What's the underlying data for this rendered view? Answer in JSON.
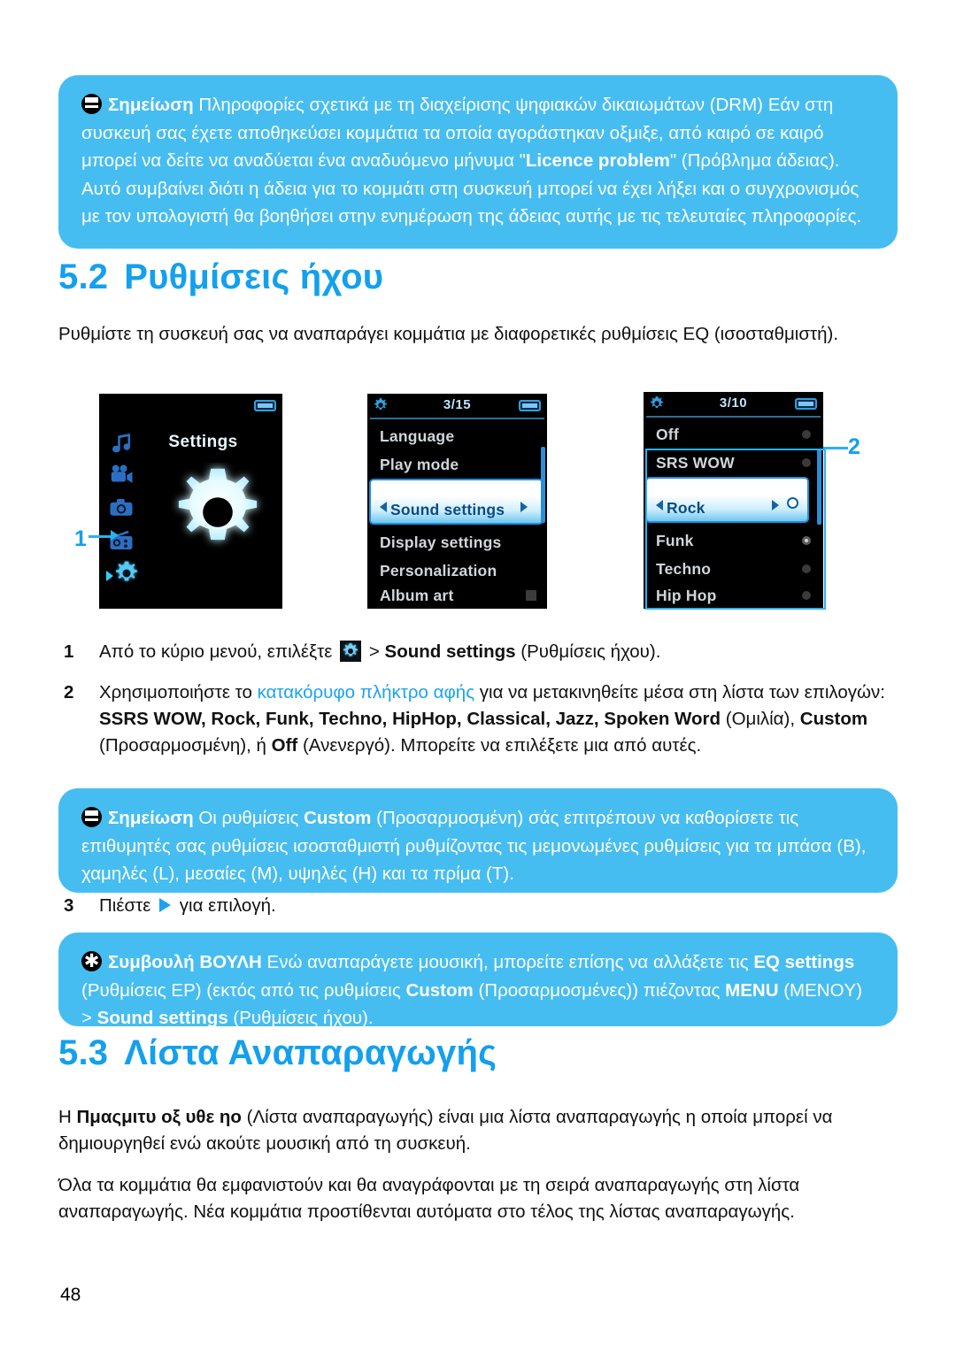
{
  "page_number": "48",
  "notes": {
    "note_drm": {
      "icon": "note-icon",
      "label": "Σημείωση",
      "text": " Πληροφορίες σχετικά με τη διαχείρισης ψηφιακών δικαιωμάτων (DRM) Εάν στη συσκευή σας έχετε αποθηκεύσει κομμάτια τα οποία αγοράστηκαν οξμιξε, από καιρό σε καιρό μπορεί να δείτε να αναδύεται ένα αναδυόμενο μήνυμα \"",
      "kw1": "Licence problem",
      "text2": "\" (Πρόβλημα άδειας). Αυτό συμβαίνει διότι η άδεια για το κομμάτι στη συσκευή μπορεί να έχει λήξει και ο συγχρονισμός με τον υπολογιστή θα βοηθήσει στην ενημέρωση της άδειας αυτής με τις τελευταίες πληροφορίες."
    },
    "note_custom": {
      "icon": "note-icon",
      "label": "Σημείωση",
      "text": " Οι ρυθμίσεις ",
      "kw1": "Custom",
      "text2": " (Προσαρμοσμένη) σάς επιτρέπουν να καθορίσετε τις επιθυμητές σας ρυθμίσεις ισοσταθμιστή ρυθμίζοντας τις μεμονωμένες ρυθμίσεις για τα μπάσα (B), χαμηλές (L), μεσαίες (M), υψηλές (H) και τα πρίμα (T)."
    },
    "tip_eq": {
      "icon": "tip-icon",
      "label": "Συμβουλή ΒΟΥΛΗ",
      "text": " Ενώ αναπαράγετε μουσική, μπορείτε επίσης να αλλάξετε τις ",
      "kw1": "EQ settings",
      "text2": " (Ρυθμίσεις EP) (εκτός από τις ρυθμίσεις ",
      "kw2": "Custom",
      "text3": " (Προσαρμοσμένες)) πιέζοντας ",
      "kw3": "MENU",
      "text4": " (MENOY) > ",
      "kw4": "Sound settings",
      "text5": " (Ρυθμίσεις ήχου)."
    }
  },
  "sections": {
    "s52": {
      "number": "5.2",
      "title": "Ρυθμίσεις ήχου",
      "intro": "Ρυθμίστε τη συσκευή σας να αναπαράγει κομμάτια με διαφορετικές ρυθμίσεις EQ (ισοσταθμιστή)."
    },
    "s53": {
      "number": "5.3",
      "title": "Λίστα Αναπαραγωγής",
      "para1_pre": "Η ",
      "para1_kw": "Πμαςμιτυ οξ υθε ηο",
      "para1_post": " (Λίστα αναπαραγωγής) είναι μια λίστα αναπαραγωγής η οποία μπορεί να δημιουργηθεί ενώ ακούτε μουσική από τη συσκευή.",
      "para2": "Όλα τα κομμάτια θα εμφανιστούν και θα αναγράφονται με τη σειρά αναπαραγωγής στη λίστα αναπαραγωγής. Νέα κομμάτια προστίθενται αυτόματα στο τέλος της λίστας αναπαραγωγής."
    }
  },
  "steps": [
    {
      "number": "1",
      "pre": "Από το κύριο μενού, επιλέξτε ",
      "icon": "settings-gear-icon",
      "mid": " > ",
      "kw": "Sound settings",
      "post": " (Ρυθμίσεις ήχου)."
    },
    {
      "number": "2",
      "pre": "Χρησιμοποιήστε το ",
      "link": "κατακόρυφο πλήκτρο αφής",
      "mid": " για να μετακινηθείτε μέσα στη λίστα των επιλογών: ",
      "options_bold": "SSRS WOW, Rock, Funk, Techno, HipHop, Classical, Jazz, Spoken Word",
      "post1": " (Ομιλία), ",
      "kw2": "Custom",
      "post2": " (Προσαρμοσμένη), ή ",
      "kw3": "Off",
      "post3": " (Ανενεργό). Μπορείτε να επιλέξετε μια από αυτές."
    },
    {
      "number": "3",
      "pre": "Πιέστε ",
      "icon": "play-triangle-icon",
      "post": " για επιλογή."
    }
  ],
  "callouts": [
    {
      "label": "1",
      "target": "settings-menu-icon"
    },
    {
      "label": "2",
      "target": "eq-option-list"
    }
  ],
  "device_screens": {
    "screen_main_menu": {
      "name": "main-menu-screen",
      "title": "Settings",
      "sidebar_icons": [
        "music-note-icon",
        "video-camera-icon",
        "photo-camera-icon",
        "radio-icon",
        "gear-icon"
      ],
      "selected_icon_index": 4,
      "battery": "battery-icon",
      "center_icon": "gear-icon"
    },
    "screen_settings_list": {
      "name": "settings-list-screen",
      "status_count": "3/15",
      "status_icon": "gear-icon",
      "battery": "battery-icon",
      "rows": [
        {
          "label": "Language",
          "highlighted": false,
          "dot": "none"
        },
        {
          "label": "Play mode",
          "highlighted": false,
          "dot": "none"
        },
        {
          "label": "Sound settings",
          "highlighted": true,
          "dot": "none"
        },
        {
          "label": "Display settings",
          "highlighted": false,
          "dot": "none"
        },
        {
          "label": "Personalization",
          "highlighted": false,
          "dot": "none"
        },
        {
          "label": "Album art",
          "highlighted": false,
          "dot": "square"
        }
      ]
    },
    "screen_eq_list": {
      "name": "eq-list-screen",
      "status_count": "3/10",
      "status_icon": "gear-icon",
      "battery": "battery-icon",
      "rows": [
        {
          "label": "Off",
          "highlighted": false,
          "dot": "empty"
        },
        {
          "label": "SRS WOW",
          "highlighted": false,
          "dot": "empty"
        },
        {
          "label": "Rock",
          "highlighted": true,
          "dot": "radio"
        },
        {
          "label": "Funk",
          "highlighted": false,
          "dot": "filled"
        },
        {
          "label": "Techno",
          "highlighted": false,
          "dot": "empty"
        },
        {
          "label": "Hip Hop",
          "highlighted": false,
          "dot": "empty"
        }
      ]
    }
  },
  "colors": {
    "callout_bg": "#46bdf0",
    "heading_blue": "#13a0ee",
    "link_blue": "#1ba3f2",
    "accent_line": "#2ab0f5"
  }
}
